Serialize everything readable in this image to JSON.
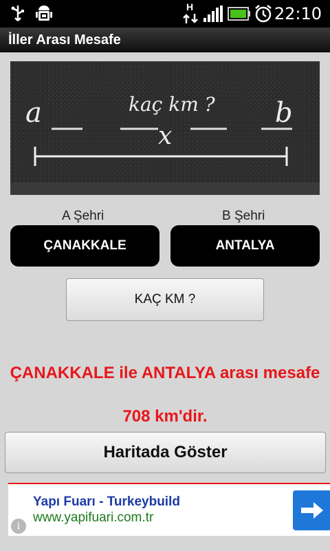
{
  "status_bar": {
    "time": "22:10",
    "network_label": "H",
    "icons": [
      "usb-icon",
      "android-debug-icon",
      "network-h-icon",
      "signal-icon",
      "battery-icon",
      "alarm-icon"
    ]
  },
  "app": {
    "title": "İller Arası Mesafe"
  },
  "banner": {
    "point_a": "a",
    "question": "kaç km ?",
    "unknown": "x",
    "point_b": "b"
  },
  "cities": {
    "a_label": "A Şehri",
    "b_label": "B Şehri",
    "a_value": "ÇANAKKALE",
    "b_value": "ANTALYA"
  },
  "calculate_button": "KAÇ KM ?",
  "result": {
    "line1": "ÇANAKKALE ile ANTALYA arası mesafe",
    "line2": "708 km'dir."
  },
  "map_button": "Haritada Göster",
  "ad": {
    "title": "Yapı Fuarı - Turkeybuild",
    "url": "www.yapifuari.com.tr",
    "info_symbol": "i"
  },
  "colors": {
    "result_red": "#e8161a",
    "ad_arrow_blue": "#1f78d9",
    "background": "#d6d6d6"
  }
}
